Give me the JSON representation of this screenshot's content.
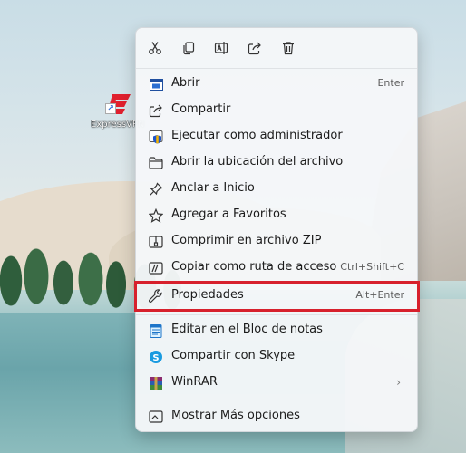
{
  "desktop": {
    "icon_label": "ExpressVPN"
  },
  "quick_actions": [
    {
      "name": "cut",
      "icon": "scissors-icon"
    },
    {
      "name": "copy",
      "icon": "copy-icon"
    },
    {
      "name": "rename",
      "icon": "rename-icon"
    },
    {
      "name": "share",
      "icon": "share-icon"
    },
    {
      "name": "delete",
      "icon": "trash-icon"
    }
  ],
  "menu": {
    "items": [
      {
        "label": "Abrir",
        "shortcut": "Enter",
        "icon": "open-window-icon"
      },
      {
        "label": "Compartir",
        "shortcut": "",
        "icon": "share-icon"
      },
      {
        "label": "Ejecutar como administrador",
        "shortcut": "",
        "icon": "shield-icon"
      },
      {
        "label": "Abrir la ubicación del archivo",
        "shortcut": "",
        "icon": "folder-icon"
      },
      {
        "label": "Anclar a Inicio",
        "shortcut": "",
        "icon": "pin-icon"
      },
      {
        "label": "Agregar a Favoritos",
        "shortcut": "",
        "icon": "star-icon"
      },
      {
        "label": "Comprimir en archivo ZIP",
        "shortcut": "",
        "icon": "zip-icon"
      },
      {
        "label": "Copiar como ruta de acceso",
        "shortcut": "Ctrl+Shift+C",
        "icon": "copy-path-icon"
      },
      {
        "label": "Propiedades",
        "shortcut": "Alt+Enter",
        "icon": "wrench-icon"
      },
      {
        "label": "Editar en el Bloc de notas",
        "shortcut": "",
        "icon": "notepad-icon"
      },
      {
        "label": "Compartir con Skype",
        "shortcut": "",
        "icon": "skype-icon"
      },
      {
        "label": "WinRAR",
        "shortcut": "",
        "icon": "winrar-icon",
        "submenu_arrow": "›"
      },
      {
        "label": "Mostrar Más opciones",
        "shortcut": "",
        "icon": "more-options-icon"
      }
    ]
  },
  "colors": {
    "highlight_border": "#d7202c",
    "accent": "#0a5fbf"
  }
}
